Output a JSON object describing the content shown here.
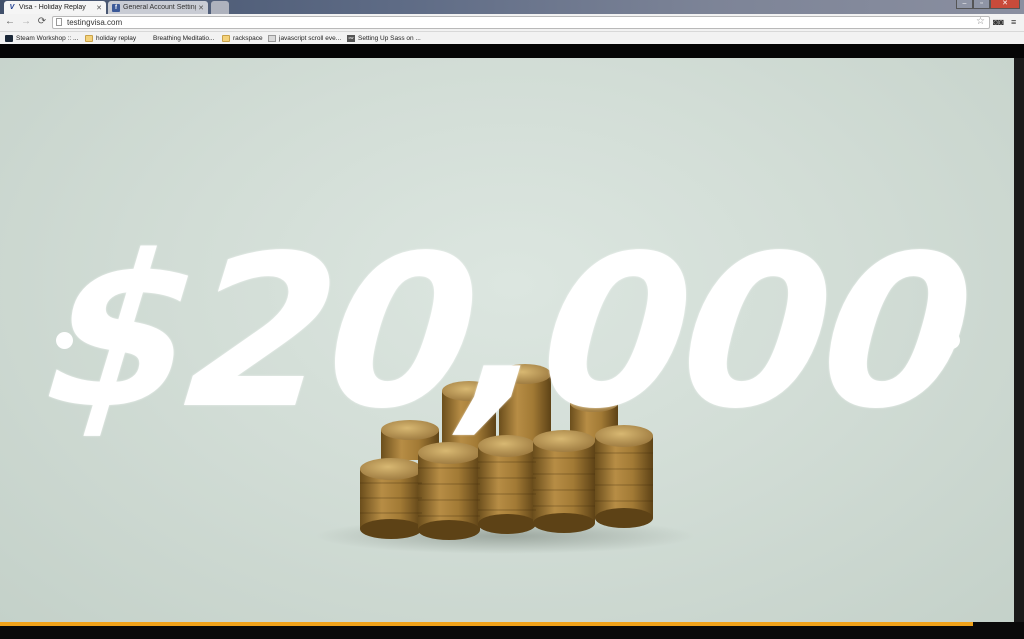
{
  "tabs": [
    {
      "label": "Visa - Holiday Replay",
      "close": "✕",
      "favicon": "V"
    },
    {
      "label": "General Account Settings",
      "close": "✕",
      "favicon": "f"
    }
  ],
  "address_bar": {
    "url": "testingvisa.com"
  },
  "bookmarks": [
    {
      "label": "Steam Workshop :: ...",
      "icon": "steam-icon"
    },
    {
      "label": "holiday replay",
      "icon": "folder-icon"
    },
    {
      "label": "Breathing Meditatio...",
      "icon": "none"
    },
    {
      "label": "rackspace",
      "icon": "folder-icon"
    },
    {
      "label": "javascript scroll eve...",
      "icon": "javascript-icon"
    },
    {
      "label": "Setting Up Sass on ...",
      "icon": "cw-icon"
    }
  ],
  "hero": {
    "amount": "$20,000"
  },
  "progress": {
    "fraction": 0.95,
    "color": "#f0a21a"
  },
  "colors": {
    "background": "#d2ddd6",
    "accent": "#f0a21a",
    "text": "#ffffff"
  }
}
